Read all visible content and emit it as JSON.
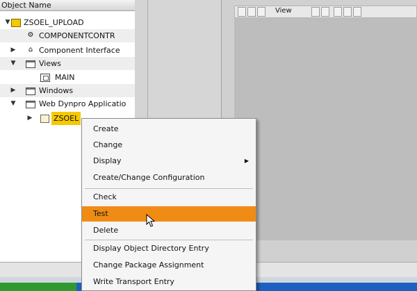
{
  "tree": {
    "header": "Object Name",
    "rows": [
      {
        "label": "ZSOEL_UPLOAD",
        "expander": "▼",
        "icon": "yellow-component"
      },
      {
        "label": "COMPONENTCONTR",
        "expander": "",
        "icon": "controller"
      },
      {
        "label": "Component Interface",
        "expander": "▶",
        "icon": "interface"
      },
      {
        "label": "Views",
        "expander": "▼",
        "icon": "folder"
      },
      {
        "label": "MAIN",
        "expander": "",
        "icon": "view"
      },
      {
        "label": "Windows",
        "expander": "▶",
        "icon": "window-folder"
      },
      {
        "label": "Web Dynpro Applicatio",
        "expander": "▼",
        "icon": "window-folder"
      },
      {
        "label": "ZSOEL",
        "expander": "▶",
        "icon": "web-dynpro-app",
        "selected": true
      }
    ]
  },
  "right_toolbar": {
    "label": "View"
  },
  "context_menu": {
    "items": [
      {
        "label": "Create",
        "has_submenu": false
      },
      {
        "label": "Change",
        "has_submenu": false
      },
      {
        "label": "Display",
        "has_submenu": true
      },
      {
        "label": "Create/Change Configuration",
        "has_submenu": false
      },
      {
        "label": "Check",
        "has_submenu": false
      },
      {
        "label": "Test",
        "has_submenu": false,
        "highlighted": true
      },
      {
        "label": "Delete",
        "has_submenu": false
      },
      {
        "label": "Display Object Directory Entry",
        "has_submenu": false
      },
      {
        "label": "Change Package Assignment",
        "has_submenu": false
      },
      {
        "label": "Write Transport Entry",
        "has_submenu": false
      }
    ]
  },
  "colors": {
    "highlight": "#f08c14",
    "selected_node": "#f6c800",
    "taskbar": "#1f5fbf"
  }
}
